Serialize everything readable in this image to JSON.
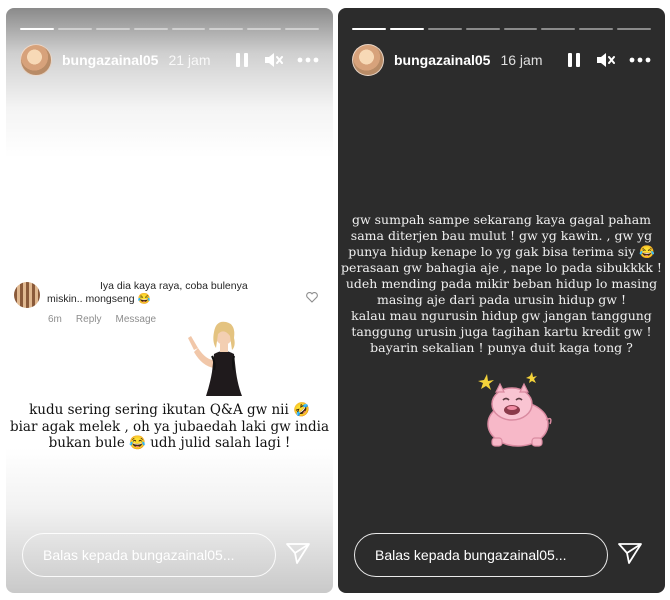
{
  "stories": [
    {
      "username": "bungazainal05",
      "time": "21 jam",
      "progress_segments": 8,
      "progress_done": 1,
      "qa": {
        "comment_line1": "Iya dia kaya raya, coba bulenya",
        "comment_line2": "miskin.. mongseng 😂",
        "age": "6m",
        "reply_label": "Reply",
        "message_label": "Message"
      },
      "caption": "kudu sering sering ikutan Q&A gw nii 🤣\nbiar agak melek , oh ya jubaedah laki gw india\nbukan bule 😂  udh julid salah lagi !",
      "reply_placeholder": "Balas kepada bungazainal05..."
    },
    {
      "username": "bungazainal05",
      "time": "16 jam",
      "progress_segments": 8,
      "progress_done": 2,
      "caption": "gw sumpah sampe sekarang kaya gagal paham\nsama diterjen bau mulut ! gw yg kawin. , gw yg\npunya hidup kenape lo yg gak bisa terima siy 😂\nperasaan gw bahagia aje , nape lo pada sibukkkk !\nudeh mending pada mikir  beban hidup lo masing\nmasing aje dari pada urusin hidup gw !\nkalau mau ngurusin hidup gw jangan tanggung\ntanggung urusin juga tagihan kartu kredit gw !\nbayarin sekalian ! punya duit kaga tong ?",
      "reply_placeholder": "Balas kepada bungazainal05..."
    }
  ],
  "icons": {
    "pause": "pause-icon",
    "mute": "mute-icon",
    "more": "more-icon",
    "send": "send-icon",
    "heart": "heart-icon"
  }
}
